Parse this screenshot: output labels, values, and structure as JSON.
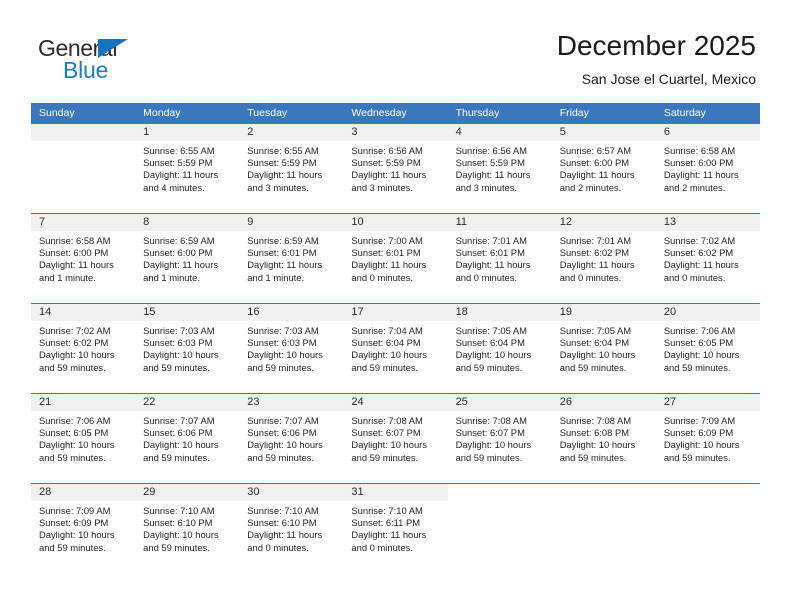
{
  "brand": {
    "name_top": "General",
    "name_bottom": "Blue",
    "triangle_color": "#1573bf",
    "top_color": "#2b2b2b",
    "bottom_color": "#1d7cc6"
  },
  "header": {
    "title": "December 2025",
    "subtitle": "San Jose el Cuartel, Mexico"
  },
  "theme": {
    "header_blue": "#3b77bc",
    "daynum_strip_gray": "#f0f0f0",
    "text": "#232323"
  },
  "weekdays": [
    "Sunday",
    "Monday",
    "Tuesday",
    "Wednesday",
    "Thursday",
    "Friday",
    "Saturday"
  ],
  "weeks": [
    [
      {
        "day": "",
        "sunrise": "",
        "sunset": "",
        "daylight": "",
        "empty": true
      },
      {
        "day": "1",
        "sunrise": "Sunrise: 6:55 AM",
        "sunset": "Sunset: 5:59 PM",
        "daylight": "Daylight: 11 hours and 4 minutes."
      },
      {
        "day": "2",
        "sunrise": "Sunrise: 6:55 AM",
        "sunset": "Sunset: 5:59 PM",
        "daylight": "Daylight: 11 hours and 3 minutes."
      },
      {
        "day": "3",
        "sunrise": "Sunrise: 6:56 AM",
        "sunset": "Sunset: 5:59 PM",
        "daylight": "Daylight: 11 hours and 3 minutes."
      },
      {
        "day": "4",
        "sunrise": "Sunrise: 6:56 AM",
        "sunset": "Sunset: 5:59 PM",
        "daylight": "Daylight: 11 hours and 3 minutes."
      },
      {
        "day": "5",
        "sunrise": "Sunrise: 6:57 AM",
        "sunset": "Sunset: 6:00 PM",
        "daylight": "Daylight: 11 hours and 2 minutes."
      },
      {
        "day": "6",
        "sunrise": "Sunrise: 6:58 AM",
        "sunset": "Sunset: 6:00 PM",
        "daylight": "Daylight: 11 hours and 2 minutes."
      }
    ],
    [
      {
        "day": "7",
        "sunrise": "Sunrise: 6:58 AM",
        "sunset": "Sunset: 6:00 PM",
        "daylight": "Daylight: 11 hours and 1 minute."
      },
      {
        "day": "8",
        "sunrise": "Sunrise: 6:59 AM",
        "sunset": "Sunset: 6:00 PM",
        "daylight": "Daylight: 11 hours and 1 minute."
      },
      {
        "day": "9",
        "sunrise": "Sunrise: 6:59 AM",
        "sunset": "Sunset: 6:01 PM",
        "daylight": "Daylight: 11 hours and 1 minute."
      },
      {
        "day": "10",
        "sunrise": "Sunrise: 7:00 AM",
        "sunset": "Sunset: 6:01 PM",
        "daylight": "Daylight: 11 hours and 0 minutes."
      },
      {
        "day": "11",
        "sunrise": "Sunrise: 7:01 AM",
        "sunset": "Sunset: 6:01 PM",
        "daylight": "Daylight: 11 hours and 0 minutes."
      },
      {
        "day": "12",
        "sunrise": "Sunrise: 7:01 AM",
        "sunset": "Sunset: 6:02 PM",
        "daylight": "Daylight: 11 hours and 0 minutes."
      },
      {
        "day": "13",
        "sunrise": "Sunrise: 7:02 AM",
        "sunset": "Sunset: 6:02 PM",
        "daylight": "Daylight: 11 hours and 0 minutes."
      }
    ],
    [
      {
        "day": "14",
        "sunrise": "Sunrise: 7:02 AM",
        "sunset": "Sunset: 6:02 PM",
        "daylight": "Daylight: 10 hours and 59 minutes."
      },
      {
        "day": "15",
        "sunrise": "Sunrise: 7:03 AM",
        "sunset": "Sunset: 6:03 PM",
        "daylight": "Daylight: 10 hours and 59 minutes."
      },
      {
        "day": "16",
        "sunrise": "Sunrise: 7:03 AM",
        "sunset": "Sunset: 6:03 PM",
        "daylight": "Daylight: 10 hours and 59 minutes."
      },
      {
        "day": "17",
        "sunrise": "Sunrise: 7:04 AM",
        "sunset": "Sunset: 6:04 PM",
        "daylight": "Daylight: 10 hours and 59 minutes."
      },
      {
        "day": "18",
        "sunrise": "Sunrise: 7:05 AM",
        "sunset": "Sunset: 6:04 PM",
        "daylight": "Daylight: 10 hours and 59 minutes."
      },
      {
        "day": "19",
        "sunrise": "Sunrise: 7:05 AM",
        "sunset": "Sunset: 6:04 PM",
        "daylight": "Daylight: 10 hours and 59 minutes."
      },
      {
        "day": "20",
        "sunrise": "Sunrise: 7:06 AM",
        "sunset": "Sunset: 6:05 PM",
        "daylight": "Daylight: 10 hours and 59 minutes."
      }
    ],
    [
      {
        "day": "21",
        "sunrise": "Sunrise: 7:06 AM",
        "sunset": "Sunset: 6:05 PM",
        "daylight": "Daylight: 10 hours and 59 minutes."
      },
      {
        "day": "22",
        "sunrise": "Sunrise: 7:07 AM",
        "sunset": "Sunset: 6:06 PM",
        "daylight": "Daylight: 10 hours and 59 minutes."
      },
      {
        "day": "23",
        "sunrise": "Sunrise: 7:07 AM",
        "sunset": "Sunset: 6:06 PM",
        "daylight": "Daylight: 10 hours and 59 minutes."
      },
      {
        "day": "24",
        "sunrise": "Sunrise: 7:08 AM",
        "sunset": "Sunset: 6:07 PM",
        "daylight": "Daylight: 10 hours and 59 minutes."
      },
      {
        "day": "25",
        "sunrise": "Sunrise: 7:08 AM",
        "sunset": "Sunset: 6:07 PM",
        "daylight": "Daylight: 10 hours and 59 minutes."
      },
      {
        "day": "26",
        "sunrise": "Sunrise: 7:08 AM",
        "sunset": "Sunset: 6:08 PM",
        "daylight": "Daylight: 10 hours and 59 minutes."
      },
      {
        "day": "27",
        "sunrise": "Sunrise: 7:09 AM",
        "sunset": "Sunset: 6:09 PM",
        "daylight": "Daylight: 10 hours and 59 minutes."
      }
    ],
    [
      {
        "day": "28",
        "sunrise": "Sunrise: 7:09 AM",
        "sunset": "Sunset: 6:09 PM",
        "daylight": "Daylight: 10 hours and 59 minutes."
      },
      {
        "day": "29",
        "sunrise": "Sunrise: 7:10 AM",
        "sunset": "Sunset: 6:10 PM",
        "daylight": "Daylight: 10 hours and 59 minutes."
      },
      {
        "day": "30",
        "sunrise": "Sunrise: 7:10 AM",
        "sunset": "Sunset: 6:10 PM",
        "daylight": "Daylight: 11 hours and 0 minutes."
      },
      {
        "day": "31",
        "sunrise": "Sunrise: 7:10 AM",
        "sunset": "Sunset: 6:11 PM",
        "daylight": "Daylight: 11 hours and 0 minutes."
      },
      {
        "day": "",
        "sunrise": "",
        "sunset": "",
        "daylight": "",
        "empty": true,
        "blank": true
      },
      {
        "day": "",
        "sunrise": "",
        "sunset": "",
        "daylight": "",
        "empty": true,
        "blank": true
      },
      {
        "day": "",
        "sunrise": "",
        "sunset": "",
        "daylight": "",
        "empty": true,
        "blank": true
      }
    ]
  ]
}
